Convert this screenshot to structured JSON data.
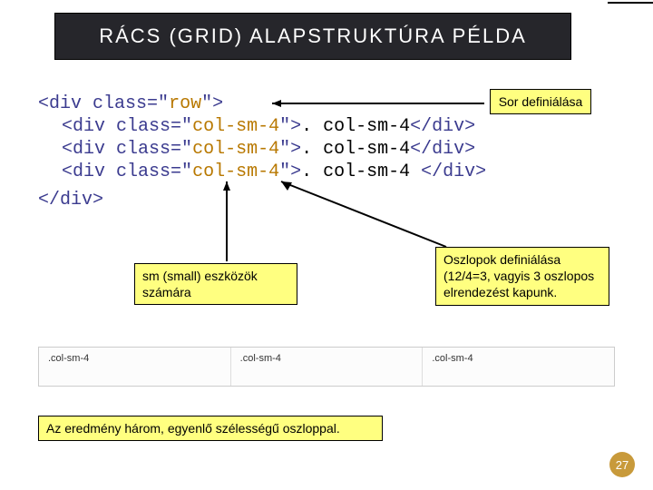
{
  "title": "RÁCS (GRID) ALAPSTRUKTÚRA PÉLDA",
  "code": {
    "div_open": "<div",
    "class_attr": "class",
    "eq_q": "=\"",
    "q_close": "\">",
    "row_val": "row",
    "col_val": "col-sm-4",
    "col_content_a": ". col-sm-4",
    "col_content_b": ". col-sm-4",
    "col_content_c": ". col-sm-4 ",
    "div_close": "</div>",
    "div_close_final": "</div>"
  },
  "callouts": {
    "row_def": "Sor definiálása",
    "sm_note": "sm (small) eszközök számára",
    "col_def": "Oszlopok definiálása (12/4=3, vagyis 3 oszlopos elrendezést kapunk.",
    "result": "Az eredmény három, egyenlő szélességű oszloppal."
  },
  "demo_cells": {
    "c1": ".col-sm-4",
    "c2": ".col-sm-4",
    "c3": ".col-sm-4"
  },
  "page_number": "27"
}
